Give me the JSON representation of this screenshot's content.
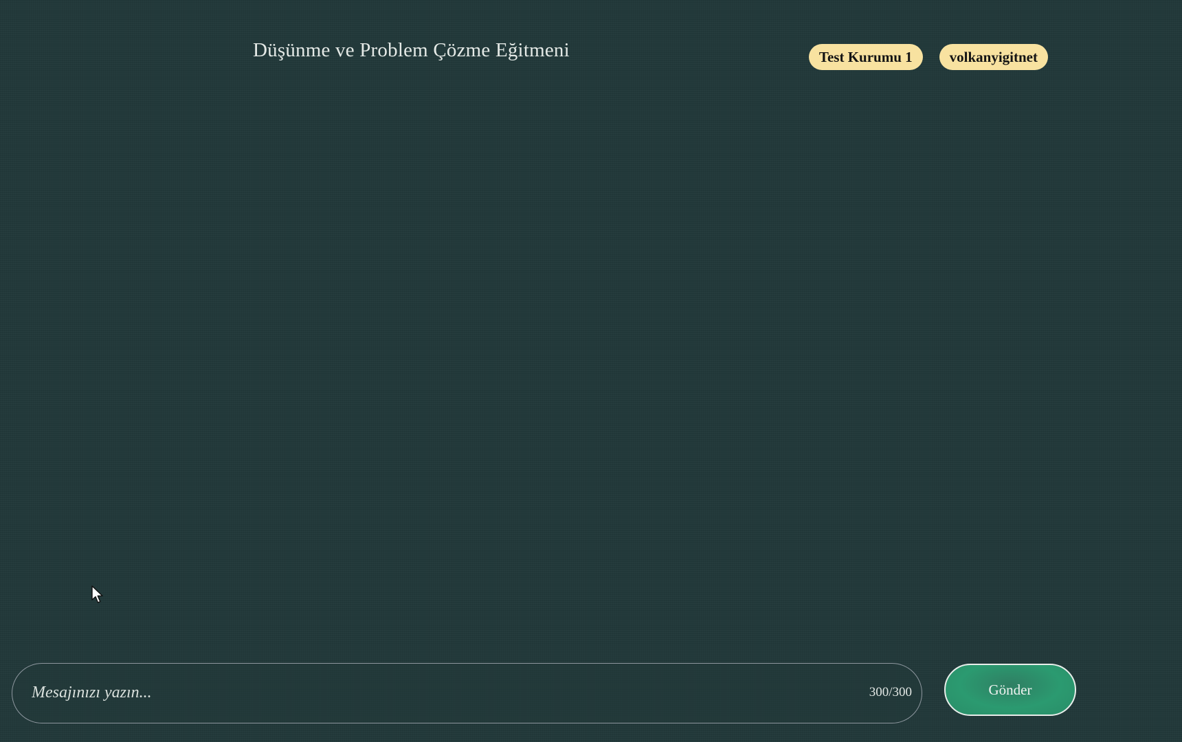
{
  "header": {
    "title": "Düşünme ve Problem Çözme Eğitmeni",
    "organization_badge": "Test Kurumu 1",
    "user_badge": "volkanyigitnet"
  },
  "composer": {
    "placeholder": "Mesajınızı yazın...",
    "value": "",
    "char_counter": "300/300",
    "send_label": "Gönder"
  },
  "colors": {
    "background": "#22393a",
    "badge": "#f8e2a0",
    "send_button": "#2b9a70"
  }
}
